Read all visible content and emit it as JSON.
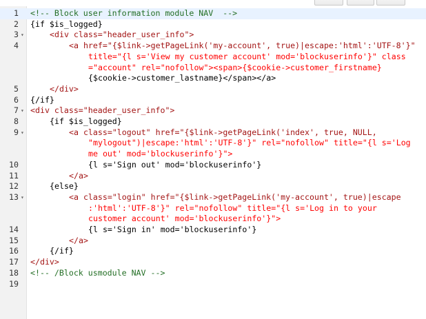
{
  "editor": {
    "lines": [
      {
        "n": "1",
        "fold": "",
        "text": "<!-- Block user information module NAV  -->",
        "kind": "cmt",
        "indent": 0
      },
      {
        "n": "2",
        "fold": "",
        "text": "{if $is_logged}",
        "kind": "tpl",
        "indent": 0
      },
      {
        "n": "3",
        "fold": "▾",
        "text": "<div class=\"header_user_info\">",
        "kind": "tag",
        "indent": 1
      },
      {
        "n": "4",
        "fold": "",
        "text": "<a href=\"{$link->getPageLink('my-account', true)|escape:'html':'UTF-8'}\"",
        "kind": "tag",
        "indent": 2
      },
      {
        "n": "",
        "fold": "",
        "text": "title=\"{l s='View my customer account' mod='blockuserinfo'}\" class",
        "kind": "attr",
        "indent": 3
      },
      {
        "n": "",
        "fold": "",
        "text": "=\"account\" rel=\"nofollow\"><span>{$cookie->customer_firstname}",
        "kind": "attr",
        "indent": 3
      },
      {
        "n": "",
        "fold": "",
        "text": "{$cookie->customer_lastname}</span></a>",
        "kind": "tpl",
        "indent": 3
      },
      {
        "n": "5",
        "fold": "",
        "text": "</div>",
        "kind": "tag",
        "indent": 1
      },
      {
        "n": "6",
        "fold": "",
        "text": "{/if}",
        "kind": "tpl",
        "indent": 0
      },
      {
        "n": "7",
        "fold": "▾",
        "text": "<div class=\"header_user_info\">",
        "kind": "tag",
        "indent": 0
      },
      {
        "n": "8",
        "fold": "",
        "text": "{if $is_logged}",
        "kind": "tpl",
        "indent": 1
      },
      {
        "n": "9",
        "fold": "▾",
        "text": "<a class=\"logout\" href=\"{$link->getPageLink('index', true, NULL,",
        "kind": "tag",
        "indent": 2
      },
      {
        "n": "",
        "fold": "",
        "text": "\"mylogout\")|escape:'html':'UTF-8'}\" rel=\"nofollow\" title=\"{l s='Log",
        "kind": "attr",
        "indent": 3
      },
      {
        "n": "",
        "fold": "",
        "text": "me out' mod='blockuserinfo'}\">",
        "kind": "attr",
        "indent": 3
      },
      {
        "n": "10",
        "fold": "",
        "text": "{l s='Sign out' mod='blockuserinfo'}",
        "kind": "tpl",
        "indent": 3
      },
      {
        "n": "11",
        "fold": "",
        "text": "</a>",
        "kind": "tag",
        "indent": 2
      },
      {
        "n": "12",
        "fold": "",
        "text": "{else}",
        "kind": "tpl",
        "indent": 1
      },
      {
        "n": "13",
        "fold": "▾",
        "text": "<a class=\"login\" href=\"{$link->getPageLink('my-account', true)|escape",
        "kind": "tag",
        "indent": 2
      },
      {
        "n": "",
        "fold": "",
        "text": ":'html':'UTF-8'}\" rel=\"nofollow\" title=\"{l s='Log in to your",
        "kind": "attr",
        "indent": 3
      },
      {
        "n": "",
        "fold": "",
        "text": "customer account' mod='blockuserinfo'}\">",
        "kind": "attr",
        "indent": 3
      },
      {
        "n": "14",
        "fold": "",
        "text": "{l s='Sign in' mod='blockuserinfo'}",
        "kind": "tpl",
        "indent": 3
      },
      {
        "n": "15",
        "fold": "",
        "text": "</a>",
        "kind": "tag",
        "indent": 2
      },
      {
        "n": "16",
        "fold": "",
        "text": "{/if}",
        "kind": "tpl",
        "indent": 1
      },
      {
        "n": "17",
        "fold": "",
        "text": "</div>",
        "kind": "tag",
        "indent": 0
      },
      {
        "n": "18",
        "fold": "",
        "text": "<!-- /Block usmodule NAV -->",
        "kind": "cmt",
        "indent": 0
      },
      {
        "n": "19",
        "fold": "",
        "text": "",
        "kind": "tpl",
        "indent": 0
      }
    ]
  },
  "colors": {
    "gutter_bg": "#f2f2f2",
    "comment": "#236e24",
    "tag": "#a31515",
    "attribute": "#ff0000",
    "string": "#0451a5",
    "active_line": "#e8f2ff"
  }
}
